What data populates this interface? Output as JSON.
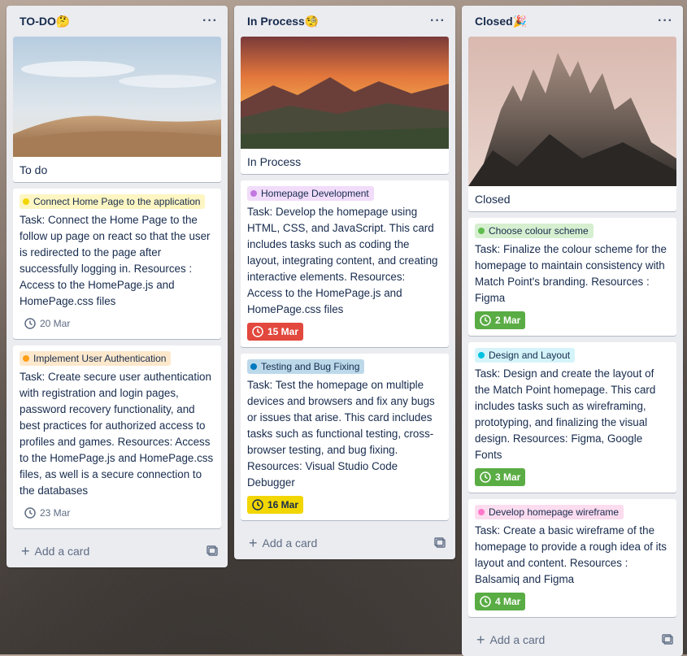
{
  "lists": [
    {
      "title": "TO-DO🤔",
      "menu": "···",
      "cover_title": "To do",
      "cards": [
        {
          "label": "Connect Home Page to the application",
          "label_color": "#f2d600",
          "label_bg": "#fdf6c2",
          "text": "Task: Connect the Home Page to the follow up page on react so that the user is redirected to the page after successfully logging in. Resources : Access to the HomePage.js and HomePage.css files",
          "due": "20 Mar",
          "due_style": "plain"
        },
        {
          "label": "Implement User Authentication",
          "label_color": "#ff9f1a",
          "label_bg": "#fde8cc",
          "text": "Task: Create secure user authentication with registration and login pages, password recovery functionality, and best practices for authorized access to profiles and games. Resources: Access to the HomePage.js and HomePage.css files, as well is a secure connection to the databases",
          "due": "23 Mar",
          "due_style": "plain"
        }
      ],
      "add_label": "Add a card"
    },
    {
      "title": "In Process🧐",
      "menu": "···",
      "cover_title": "In Process",
      "cards": [
        {
          "label": "Homepage Development",
          "label_color": "#c377e0",
          "label_bg": "#f1dcfa",
          "text": "Task: Develop the homepage using HTML, CSS, and JavaScript. This card includes tasks such as coding the layout, integrating content, and creating interactive elements. Resources: Access to the HomePage.js and HomePage.css files",
          "due": "15 Mar",
          "due_style": "red"
        },
        {
          "label": "Testing and Bug Fixing",
          "label_color": "#0079bf",
          "label_bg": "#bcd9ea",
          "text": "Task: Test the homepage on multiple devices and browsers and fix any bugs or issues that arise. This card includes tasks such as functional testing, cross-browser testing, and bug fixing. Resources: Visual Studio Code Debugger",
          "due": "16 Mar",
          "due_style": "yellow"
        }
      ],
      "add_label": "Add a card"
    },
    {
      "title": "Closed🎉",
      "menu": "···",
      "cover_title": "Closed",
      "cards": [
        {
          "label": "Choose colour scheme",
          "label_color": "#61bd4f",
          "label_bg": "#d6efd0",
          "text": "Task: Finalize the colour scheme for the homepage to maintain consistency with Match Point's branding. Resources : Figma",
          "due": "2 Mar",
          "due_style": "green"
        },
        {
          "label": "Design and Layout",
          "label_color": "#00c2e0",
          "label_bg": "#d4f4fa",
          "text": "Task: Design and create the layout of the Match Point homepage. This card includes tasks such as wireframing, prototyping, and finalizing the visual design. Resources: Figma, Google Fonts",
          "due": "3 Mar",
          "due_style": "green"
        },
        {
          "label": "Develop homepage wireframe",
          "label_color": "#ff78cb",
          "label_bg": "#fcdcef",
          "text": "Task: Create a basic wireframe of the homepage to provide a rough idea of its layout and content. Resources : Balsamiq and Figma",
          "due": "4 Mar",
          "due_style": "green"
        }
      ],
      "add_label": "Add a card"
    }
  ]
}
